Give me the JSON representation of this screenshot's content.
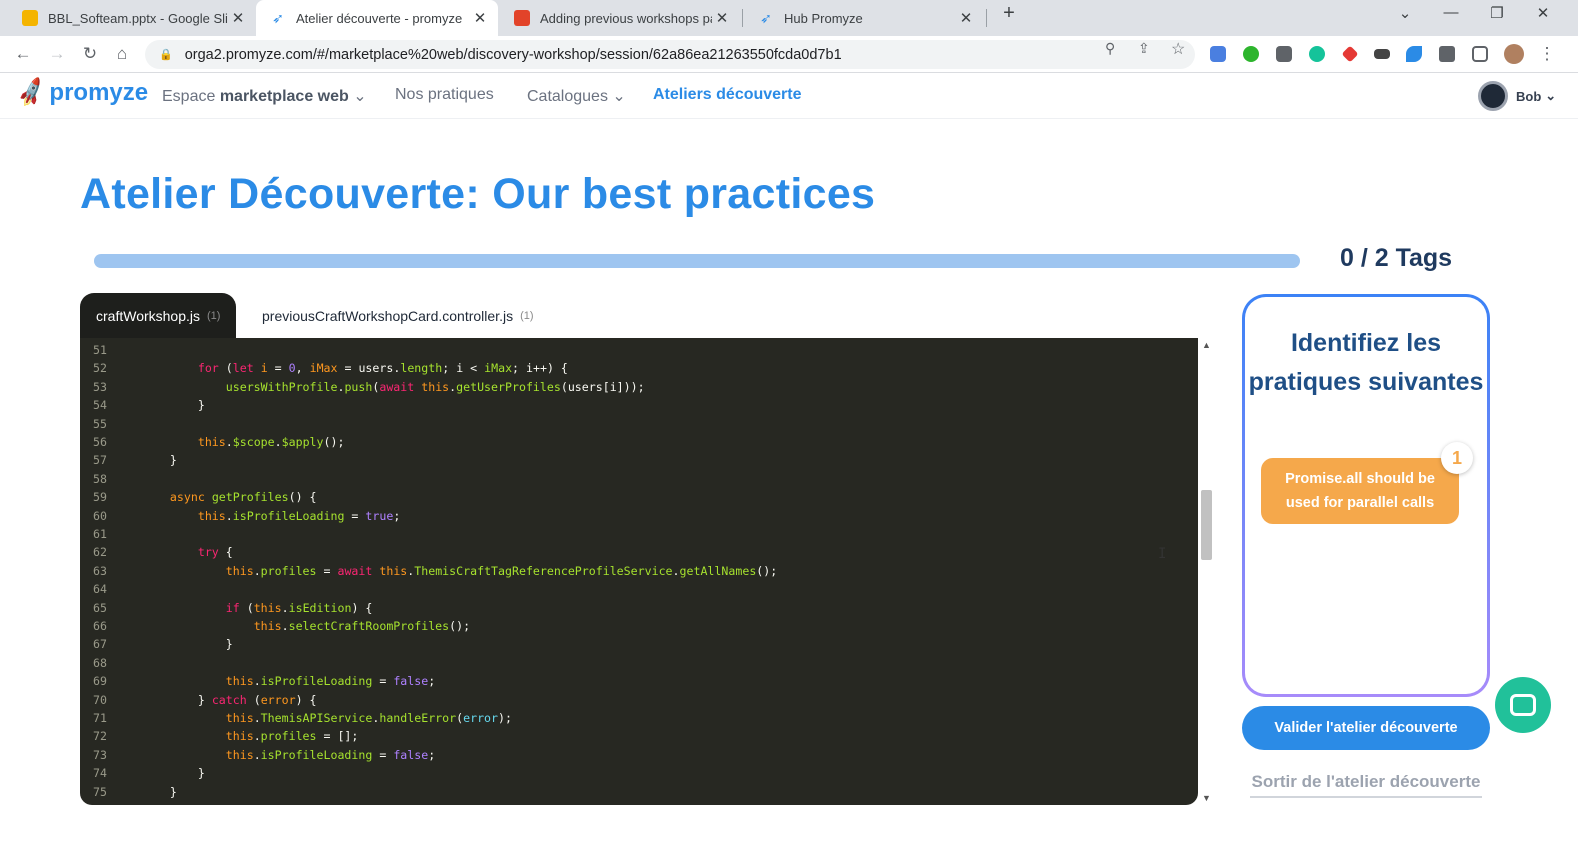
{
  "browser": {
    "tabs": [
      {
        "title": "BBL_Softeam.pptx - Google Slides",
        "icon": "google-slides-icon"
      },
      {
        "title": "Atelier découverte - promyze",
        "icon": "promyze-rocket-icon",
        "active": true
      },
      {
        "title": "Adding previous workshops page",
        "icon": "gitlab-icon"
      },
      {
        "title": "Hub Promyze",
        "icon": "promyze-rocket-icon"
      }
    ],
    "new_tab": "+",
    "controls": {
      "dropdown": "⌄",
      "minimize": "—",
      "maximize": "❐",
      "close": "✕"
    },
    "nav": {
      "back": "←",
      "forward": "→",
      "reload": "↻",
      "home": "⌂"
    },
    "url": "orga2.promyze.com/#/marketplace%20web/discovery-workshop/session/62a86ea21263550fcda0d7b1",
    "omni_icons": {
      "zoom": "⚲",
      "share": "⇪",
      "bookmark": "☆"
    },
    "menu": "⋮"
  },
  "app_nav": {
    "logo_text": "promyze",
    "space_prefix": "Espace",
    "space_name": "marketplace web",
    "chevron": "⌄",
    "links": [
      "Nos pratiques",
      "Catalogues",
      "Ateliers découverte"
    ],
    "active_link": "Ateliers découverte",
    "user": "Bob"
  },
  "workshop": {
    "title": "Atelier Découverte: Our best practices",
    "progress": 0,
    "tag_count": "0 / 2 Tags"
  },
  "files": [
    {
      "name": "craftWorkshop.js",
      "count": "(1)",
      "active": true
    },
    {
      "name": "previousCraftWorkshopCard.controller.js",
      "count": "(1)"
    }
  ],
  "code_lines": [
    {
      "n": "51",
      "html": ""
    },
    {
      "n": "52",
      "html": "        <span class=\"k\">for</span> (<span class=\"k\">let</span> <span class=\"t\">i</span> = <span class=\"n\">0</span>, <span class=\"t\">iMax</span> = users.<span class=\"f\">length</span>; i &lt; <span class=\"f\">iMax</span>; i++) {"
    },
    {
      "n": "53",
      "html": "            <span class=\"f\">usersWithProfile</span>.<span class=\"f\">push</span>(<span class=\"k\">await</span> <span class=\"t\">this</span>.<span class=\"f\">getUserProfiles</span>(users[i]));"
    },
    {
      "n": "54",
      "html": "        }"
    },
    {
      "n": "55",
      "html": ""
    },
    {
      "n": "56",
      "html": "        <span class=\"t\">this</span>.<span class=\"f\">$scope</span>.<span class=\"f\">$apply</span>();"
    },
    {
      "n": "57",
      "html": "    }"
    },
    {
      "n": "58",
      "html": ""
    },
    {
      "n": "59",
      "html": "    <span class=\"t\">async</span> <span class=\"f\">getProfiles</span>() {"
    },
    {
      "n": "60",
      "html": "        <span class=\"t\">this</span>.<span class=\"f\">isProfileLoading</span> = <span class=\"n\">true</span>;"
    },
    {
      "n": "61",
      "html": ""
    },
    {
      "n": "62",
      "html": "        <span class=\"k\">try</span> {"
    },
    {
      "n": "63",
      "html": "            <span class=\"t\">this</span>.<span class=\"f\">profiles</span> = <span class=\"k\">await</span> <span class=\"t\">this</span>.<span class=\"f\">ThemisCraftTagReferenceProfileService</span>.<span class=\"f\">getAllNames</span>();"
    },
    {
      "n": "64",
      "html": ""
    },
    {
      "n": "65",
      "html": "            <span class=\"k\">if</span> (<span class=\"t\">this</span>.<span class=\"f\">isEdition</span>) {"
    },
    {
      "n": "66",
      "html": "                <span class=\"t\">this</span>.<span class=\"f\">selectCraftRoomProfiles</span>();"
    },
    {
      "n": "67",
      "html": "            }"
    },
    {
      "n": "68",
      "html": ""
    },
    {
      "n": "69",
      "html": "            <span class=\"t\">this</span>.<span class=\"f\">isProfileLoading</span> = <span class=\"n\">false</span>;"
    },
    {
      "n": "70",
      "html": "        } <span class=\"k\">catch</span> (<span class=\"t\">error</span>) {"
    },
    {
      "n": "71",
      "html": "            <span class=\"t\">this</span>.<span class=\"f\">ThemisAPIService</span>.<span class=\"f\">handleError</span>(<span class=\"v\">error</span>);"
    },
    {
      "n": "72",
      "html": "            <span class=\"t\">this</span>.<span class=\"f\">profiles</span> = [];"
    },
    {
      "n": "73",
      "html": "            <span class=\"t\">this</span>.<span class=\"f\">isProfileLoading</span> = <span class=\"n\">false</span>;"
    },
    {
      "n": "74",
      "html": "        }"
    },
    {
      "n": "75",
      "html": "    }"
    }
  ],
  "practices": {
    "title": "Identifiez les pratiques suivantes",
    "items": [
      {
        "label": "Promise.all should be used for parallel calls",
        "badge": "1"
      }
    ]
  },
  "validate_label": "Valider l'atelier découverte",
  "exit_label": "Sortir de l'atelier découverte",
  "colors": {
    "brand": "#2b8be6",
    "chip": "#f5a84b",
    "chat": "#21c19a",
    "editor_bg": "#272822"
  }
}
